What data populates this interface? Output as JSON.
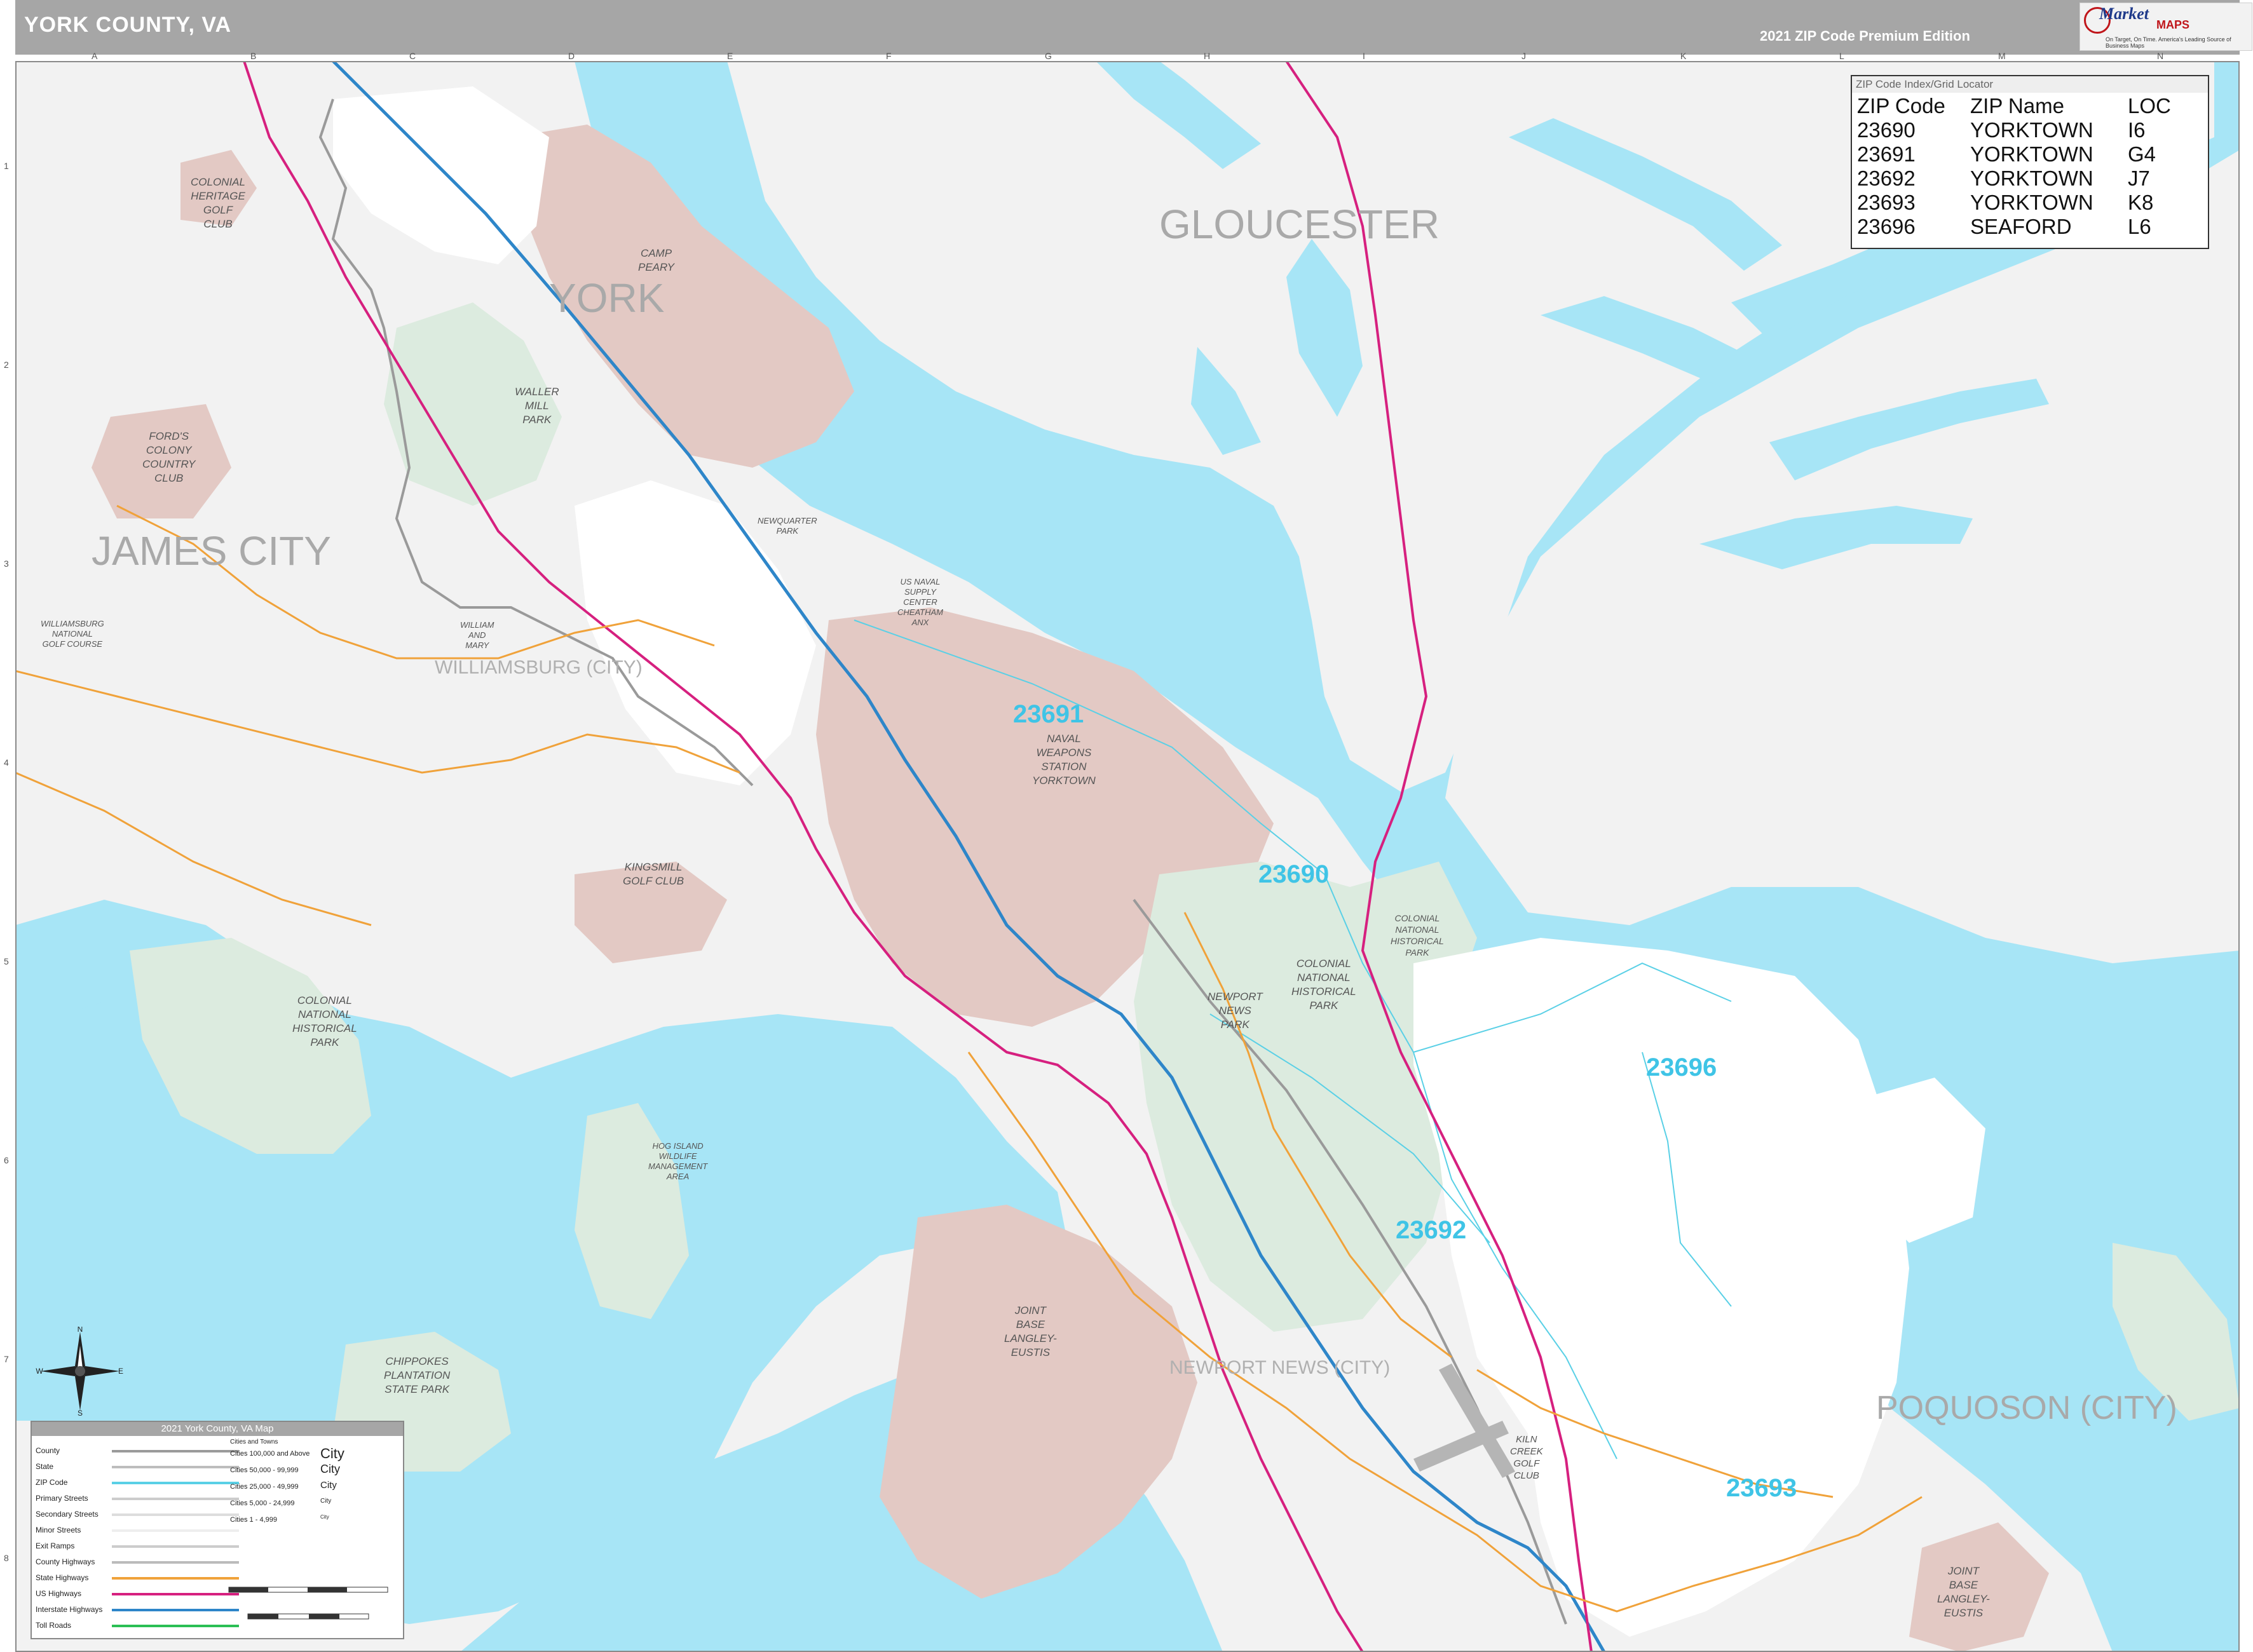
{
  "header": {
    "title": "YORK COUNTY, VA",
    "edition": "2021 ZIP Code Premium Edition",
    "logo": {
      "brand_top": "Market",
      "brand_bottom": "MAPS",
      "tagline": "On Target, On Time. America's Leading Source of Business Maps"
    }
  },
  "grid": {
    "columns": [
      "A",
      "B",
      "C",
      "D",
      "E",
      "F",
      "G",
      "H",
      "I",
      "J",
      "K",
      "L",
      "M",
      "N"
    ],
    "rows": [
      "1",
      "2",
      "3",
      "4",
      "5",
      "6",
      "7",
      "8"
    ]
  },
  "map": {
    "colors": {
      "water": "#a7e5f6",
      "land": "#f2f2f2",
      "military": "#e3c9c4",
      "park": "#dcebdf",
      "urban": "#ffffff",
      "interstate": "#2e86c9",
      "us_highway": "#d6207f",
      "state_highway": "#f0a23a",
      "zip_boundary": "#5ad0e6"
    },
    "region_labels": {
      "gloucester": "GLOUCESTER",
      "york": "YORK",
      "james_city": "JAMES CITY",
      "poquoson": "POQUOSON (CITY)",
      "williamsburg": "WILLIAMSBURG (CITY)",
      "newport_news": "NEWPORT NEWS (CITY)"
    },
    "zip_labels": [
      "23691",
      "23690",
      "23696",
      "23692",
      "23693"
    ],
    "place_labels": {
      "camp_peary": "CAMP\nPEARY",
      "colonial_heritage": "COLONIAL\nHERITAGE\nGOLF\nCLUB",
      "waller_mill": "WALLER\nMILL\nPARK",
      "fords_colony": "FORD'S\nCOLONY\nCOUNTRY\nCLUB",
      "newquarter": "NEWQUARTER\nPARK",
      "us_naval": "US NAVAL\nSUPPLY\nCENTER\nCHEATHAM\nANX",
      "naval_weapons": "NAVAL\nWEAPONS\nSTATION\nYORKTOWN",
      "williamsburg_national": "WILLIAMSBURG\nNATIONAL\nGOLF COURSE",
      "william_mary": "WILLIAM\nAND\nMARY",
      "kingsmill": "KINGSMILL\nGOLF CLUB",
      "colonial_nhp_west": "COLONIAL\nNATIONAL\nHISTORICAL\nPARK",
      "colonial_nhp_center": "COLONIAL\nNATIONAL\nHISTORICAL\nPARK",
      "colonial_nhp_small": "COLONIAL\nNATIONAL\nHISTORICAL\nPARK",
      "newport_news_park": "NEWPORT\nNEWS\nPARK",
      "hog_island": "HOG ISLAND\nWILDLIFE\nMANAGEMENT\nAREA",
      "chippokes": "CHIPPOKES\nPLANTATION\nSTATE PARK",
      "langley_eustis": "JOINT\nBASE\nLANGLEY-\nEUSTIS",
      "langley_east": "JOINT\nBASE\nLANGLEY-\nEUSTIS",
      "kiln_creek": "KILN\nCREEK\nGOLF\nCLUB"
    }
  },
  "zip_index": {
    "title": "ZIP Code Index/Grid Locator",
    "headers": [
      "ZIP Code",
      "ZIP Name",
      "LOC"
    ],
    "rows": [
      [
        "23690",
        "YORKTOWN",
        "I6"
      ],
      [
        "23691",
        "YORKTOWN",
        "G4"
      ],
      [
        "23692",
        "YORKTOWN",
        "J7"
      ],
      [
        "23693",
        "YORKTOWN",
        "K8"
      ],
      [
        "23696",
        "SEAFORD",
        "L6"
      ]
    ]
  },
  "legend": {
    "title": "2021 York County, VA Map",
    "rows": [
      "County",
      "State",
      "ZIP Code",
      "Primary Streets",
      "Secondary Streets",
      "Minor Streets",
      "Exit Ramps",
      "County Highways",
      "State Highways",
      "US Highways",
      "Interstate Highways",
      "Toll Roads"
    ],
    "city_header": "Cities and Towns",
    "city_rows": [
      "Cities 100,000 and Above",
      "Cities 50,000 - 99,999",
      "Cities 25,000 - 49,999",
      "Cities 5,000 - 24,999",
      "Cities 1 - 4,999"
    ],
    "city_samples": [
      "City",
      "City",
      "City",
      "City",
      "City"
    ]
  },
  "compass": {
    "n": "N",
    "s": "S",
    "e": "E",
    "w": "W"
  }
}
